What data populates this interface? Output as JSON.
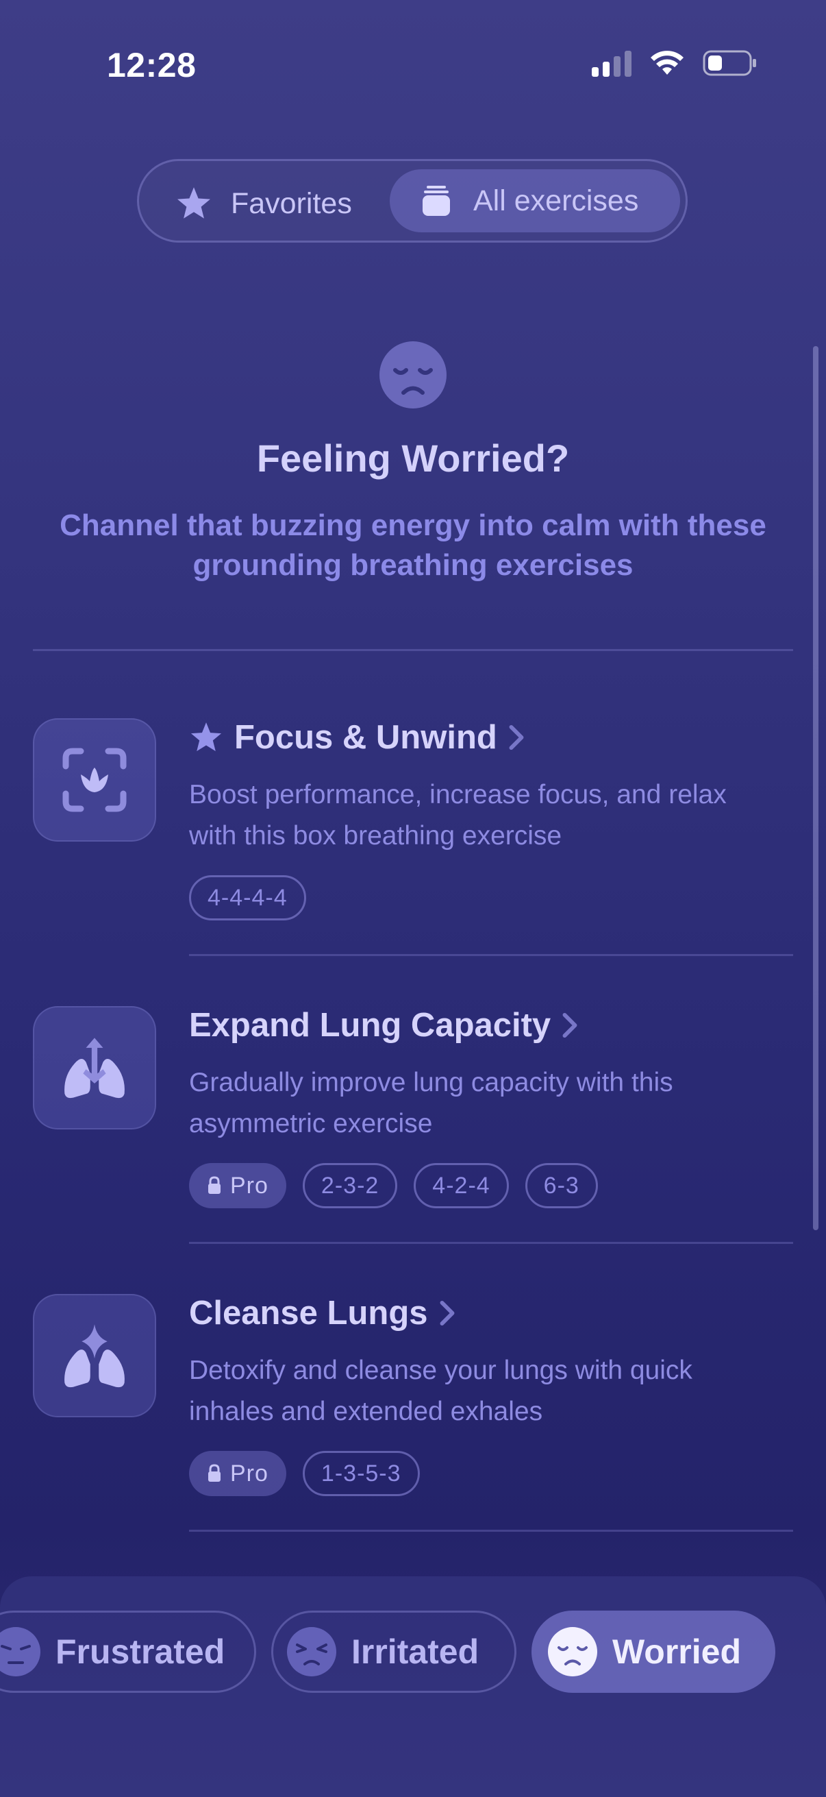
{
  "status_bar": {
    "time": "12:28"
  },
  "segmented": {
    "favorites_label": "Favorites",
    "all_label": "All exercises",
    "selected": "All exercises"
  },
  "header": {
    "mood_icon": "worried-face-icon",
    "title": "Feeling Worried?",
    "subtitle_line1": "Channel that buzzing energy into calm with these",
    "subtitle_line2": "grounding breathing exercises"
  },
  "exercises": [
    {
      "title": "Focus & Unwind",
      "favorite": true,
      "icon": "focus-lotus-icon",
      "desc_line1": "Boost performance, increase focus, and relax",
      "desc_line2": "with this box breathing exercise",
      "tags": [
        "4-4-4-4"
      ]
    },
    {
      "title": "Expand Lung Capacity",
      "favorite": false,
      "icon": "lungs-expand-icon",
      "desc_line1": "Gradually improve lung capacity with this",
      "desc_line2": "asymmetric exercise",
      "pro_label": "Pro",
      "tags": [
        "2-3-2",
        "4-2-4",
        "6-3"
      ]
    },
    {
      "title": "Cleanse Lungs",
      "favorite": false,
      "icon": "lungs-sparkle-icon",
      "desc_line1": "Detoxify and cleanse your lungs with quick",
      "desc_line2": "inhales and extended exhales",
      "pro_label": "Pro",
      "tags": [
        "1-3-5-3"
      ]
    }
  ],
  "moods": [
    {
      "label": "Frustrated",
      "icon": "frustrated-face-icon"
    },
    {
      "label": "Irritated",
      "icon": "irritated-face-icon"
    },
    {
      "label": "Worried",
      "icon": "worried-face-icon",
      "selected": true
    }
  ],
  "colors": {
    "background": "#34347e",
    "accent": "#8c8ae8",
    "text": "#d6d3fb"
  }
}
